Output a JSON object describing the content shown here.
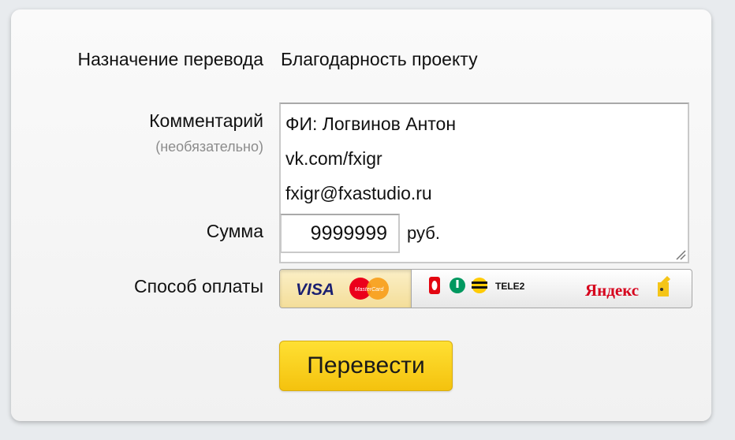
{
  "form": {
    "purpose_label": "Назначение перевода",
    "purpose_value": "Благодарность проекту",
    "comment_label": "Комментарий",
    "comment_hint": "(необязательно)",
    "comment_lines": [
      "ФИ: Логвинов Антон",
      "vk.com/fxigr",
      "fxigr@fxastudio.ru"
    ],
    "sum_label": "Сумма",
    "sum_value": "9999999",
    "currency": "руб.",
    "payment_label": "Способ оплаты",
    "payment_options": [
      {
        "id": "card",
        "text": "VISA",
        "sub": "MasterCard",
        "selected": true
      },
      {
        "id": "mobile",
        "text": "TELE2"
      },
      {
        "id": "yandex",
        "text": "Яндекс"
      }
    ],
    "submit_label": "Перевести"
  },
  "colors": {
    "accent": "#ffd52e",
    "selected_option": "#f7e6a8",
    "visa_blue": "#1a1f71",
    "mastercard_red": "#eb001b",
    "mastercard_orange": "#f79e1b",
    "yandex_red": "#d6001c"
  }
}
